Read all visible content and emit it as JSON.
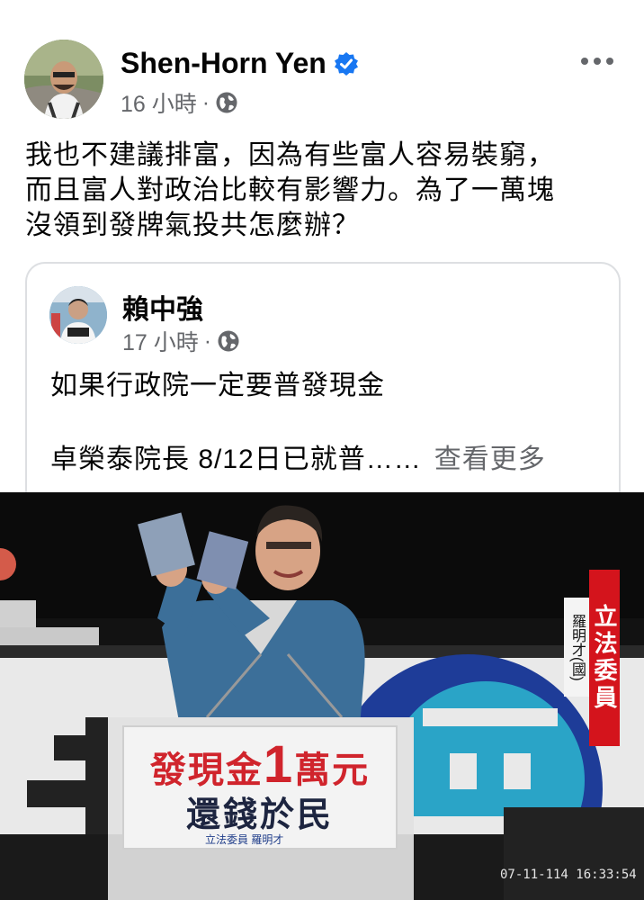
{
  "post": {
    "author": "Shen-Horn Yen",
    "time": "16 小時",
    "separator": "·",
    "text": "我也不建議排富，因為有些富人容易裝窮，\n而且富人對政治比較有影響力。為了一萬塊\n沒領到發牌氣投共怎麼辦？"
  },
  "shared": {
    "author": "賴中強",
    "time": "17 小時",
    "separator": "·",
    "line1": "如果行政院一定要普發現金",
    "line2": "卓榮泰院長 8/12日已就普……",
    "see_more": "查看更多"
  },
  "photo": {
    "sign_line1_a": "發現金",
    "sign_line1_num": "1",
    "sign_line1_b": "萬元",
    "sign_line2": "還錢於民",
    "sign_line3": "立法委員 羅明才",
    "title_tag": "立法委員",
    "name_tag": "羅明才(國)",
    "timestamp": "07-11-114 16:33:54"
  },
  "icons": {
    "verified": "verified-badge-icon",
    "globe": "globe-icon",
    "more": "more-dots-icon"
  },
  "colors": {
    "verified_blue": "#1877f2",
    "meta_gray": "#65676b",
    "tag_red": "#d4141c",
    "sign_red": "#d0242c"
  }
}
